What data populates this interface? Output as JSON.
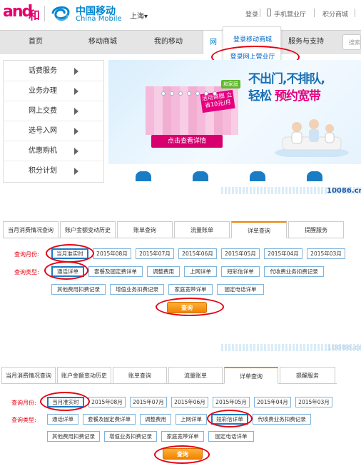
{
  "header": {
    "logo_and": "and",
    "logo_he": "和",
    "brand_cn": "中国移动",
    "brand_en": "China Mobile",
    "city": "上海",
    "links": [
      "登录",
      "手机营业厅",
      "积分商城"
    ]
  },
  "nav": {
    "items": [
      "首页",
      "移动商城",
      "我的移动",
      "网",
      "服务与支持"
    ],
    "search_placeholder": "搜索"
  },
  "dropdown": {
    "items": [
      "登录移动商城",
      "登录网上营业厅"
    ]
  },
  "side_menu": {
    "items": [
      "话费服务",
      "业务办理",
      "网上交费",
      "选号入网",
      "优惠购机",
      "积分计划"
    ]
  },
  "banner": {
    "line1": "不出门,不排队,",
    "line2_prefix": "轻松 ",
    "line2_highlight": "预约宽带",
    "tag": "活动商圈 立省10元/月",
    "button": "点击查看详情",
    "brand_tag": "和家庭"
  },
  "panel2": {
    "url": "10086.cn",
    "tabs": [
      "当月消费情况查询",
      "账户金额变动历史",
      "账单查询",
      "流量账单",
      "详单查询",
      "提醒服务"
    ],
    "active_tab": 4,
    "month_label": "查询月份:",
    "months": [
      "当月准实时",
      "2015年08月",
      "2015年07月",
      "2015年06月",
      "2015年05月",
      "2015年04月",
      "2015年03月"
    ],
    "type_label": "查询类型:",
    "types_row1": [
      "通话详单",
      "套餐及固定费详单",
      "调整费用",
      "上网详单",
      "短彩信详单",
      "代收费业务扣费记录"
    ],
    "types_row2": [
      "其他费用扣费记录",
      "增值业务扣费记录",
      "家庭宽带详单",
      "固定电话详单"
    ],
    "query_button": "查询"
  },
  "panel3": {
    "url": "10086.cn",
    "tabs": [
      "当月消费情况查询",
      "账户金额变动历史",
      "账单查询",
      "流量账单",
      "详单查询",
      "提醒服务"
    ],
    "active_tab": 4,
    "month_label": "查询月份:",
    "months": [
      "当月准实时",
      "2015年08月",
      "2015年07月",
      "2015年06月",
      "2015年05月",
      "2015年04月",
      "2015年03月"
    ],
    "type_label": "查询类型:",
    "types_row1": [
      "通话详单",
      "套餐及固定费详单",
      "调整费用",
      "上网详单",
      "短彩信详单",
      "代收费业务扣费记录"
    ],
    "types_row2": [
      "其他费用扣费记录",
      "增值业务扣费记录",
      "家庭宽带详单",
      "固定电话详单"
    ],
    "query_button": "查询"
  },
  "colors": {
    "brand_blue": "#0085d0",
    "and_pink": "#e5006e",
    "highlight_red": "#e60012",
    "query_orange": "#f08300",
    "active_tab_accent": "#f08300"
  }
}
